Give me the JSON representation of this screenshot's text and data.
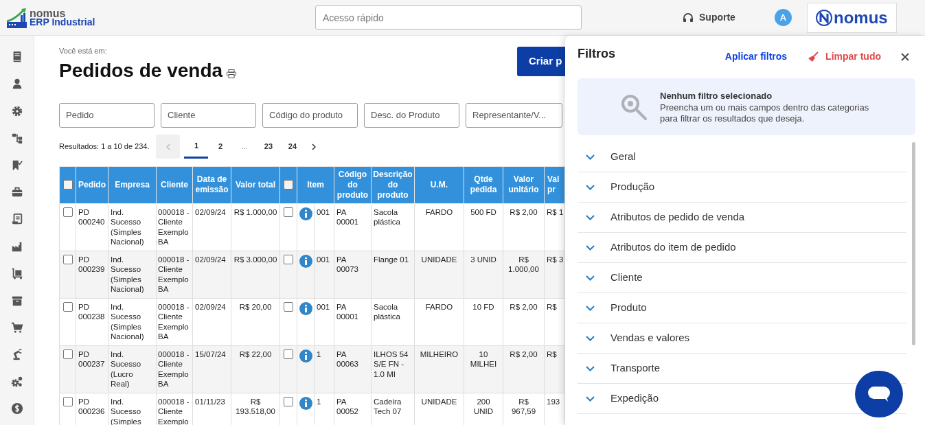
{
  "header": {
    "logo": {
      "brand": "nomus",
      "product": "ERP Industrial"
    },
    "quick_access": {
      "placeholder": "Acesso rápido"
    },
    "support": "Suporte",
    "avatar": "A",
    "partner_logo": "nomus"
  },
  "page": {
    "breadcrumb_label": "Você está em:",
    "title": "Pedidos de venda",
    "create_button": "Criar p"
  },
  "filters": [
    {
      "placeholder": "Pedido"
    },
    {
      "placeholder": "Cliente"
    },
    {
      "placeholder": "Código do produto"
    },
    {
      "placeholder": "Desc. do Produto"
    },
    {
      "placeholder": "Representante/V..."
    }
  ],
  "results": {
    "summary": "Resultados: 1 a 10 de 234.",
    "previous_disabled": true,
    "pages": [
      {
        "label": "1",
        "selected": true
      },
      {
        "label": "2",
        "selected": false
      },
      {
        "label": "...",
        "selected": false
      },
      {
        "label": "23",
        "selected": false
      },
      {
        "label": "24",
        "selected": false
      }
    ]
  },
  "table": {
    "select_all": {
      "checked": false
    },
    "item_select_all": {
      "checked": false
    },
    "columns": [
      {
        "kind": "text",
        "label": "Pedido"
      },
      {
        "kind": "text",
        "label": "Empresa"
      },
      {
        "kind": "text",
        "label": "Cliente"
      },
      {
        "kind": "text",
        "label": "Data de emissão"
      },
      {
        "kind": "text",
        "label": "Valor total"
      },
      {
        "kind": "item",
        "label": "Item"
      },
      {
        "kind": "text",
        "label": "Código do produto"
      },
      {
        "kind": "text",
        "label": "Descrição do produto"
      },
      {
        "kind": "text",
        "label": "U.M."
      },
      {
        "kind": "text",
        "label": "Qtde pedida"
      },
      {
        "kind": "text",
        "label": "Valor unitário"
      },
      {
        "kind": "text",
        "label": "Val pr"
      }
    ],
    "rows": [
      {
        "checked": false,
        "item_checked": false,
        "cells": [
          "PD 000240",
          "Ind. Sucesso (Simples Nacional)",
          "000018 - Cliente Exemplo BA",
          "02/09/24",
          "R$ 1.000,00",
          "001",
          "PA 00001",
          "Sacola plástica",
          "FARDO",
          "500 FD",
          "R$ 2,00",
          "R$ 1"
        ]
      },
      {
        "checked": false,
        "item_checked": false,
        "cells": [
          "PD 000239",
          "Ind. Sucesso (Simples Nacional)",
          "000018 - Cliente Exemplo BA",
          "02/09/24",
          "R$ 3.000,00",
          "001",
          "PA 00073",
          "Flange 01",
          "UNIDADE",
          "3 UNID",
          "R$ 1.000,00",
          "R$ 3"
        ]
      },
      {
        "checked": false,
        "item_checked": false,
        "cells": [
          "PD 000238",
          "Ind. Sucesso (Simples Nacional)",
          "000018 - Cliente Exemplo BA",
          "02/09/24",
          "R$ 20,00",
          "001",
          "PA 00001",
          "Sacola plástica",
          "FARDO",
          "10 FD",
          "R$ 2,00",
          "R$"
        ]
      },
      {
        "checked": false,
        "item_checked": false,
        "cells": [
          "PD 000237",
          "Ind. Sucesso (Lucro Real)",
          "000018 - Cliente Exemplo BA",
          "15/07/24",
          "R$ 22,00",
          "1",
          "PA 00063",
          "ILHOS 54 S/E FN - 1.0 MI",
          "MILHEIRO",
          "10 MILHEI",
          "R$ 2,00",
          "R$"
        ]
      },
      {
        "checked": false,
        "item_checked": false,
        "cells": [
          "PD 000236",
          "Ind. Sucesso (Simples",
          "000018 - Cliente Exemplo",
          "01/11/23",
          "R$ 193.518,00",
          "1",
          "PA 00052",
          "Cadeira Tech 07",
          "UNIDADE",
          "200 UNID",
          "R$ 967,59",
          "193"
        ]
      }
    ]
  },
  "filter_panel": {
    "title": "Filtros",
    "apply": "Aplicar filtros",
    "clear": "Limpar tudo",
    "info": {
      "title": "Nenhum filtro selecionado",
      "text": "Preencha um ou mais campos dentro das categorias para filtrar os resultados que deseja."
    },
    "sections": [
      {
        "label": "Geral",
        "expanded": false
      },
      {
        "label": "Produção",
        "expanded": false
      },
      {
        "label": "Atributos de pedido de venda",
        "expanded": false
      },
      {
        "label": "Atributos do item de pedido",
        "expanded": false
      },
      {
        "label": "Cliente",
        "expanded": false
      },
      {
        "label": "Produto",
        "expanded": false
      },
      {
        "label": "Vendas e valores",
        "expanded": false
      },
      {
        "label": "Transporte",
        "expanded": false
      },
      {
        "label": "Expedição",
        "expanded": false
      }
    ]
  }
}
